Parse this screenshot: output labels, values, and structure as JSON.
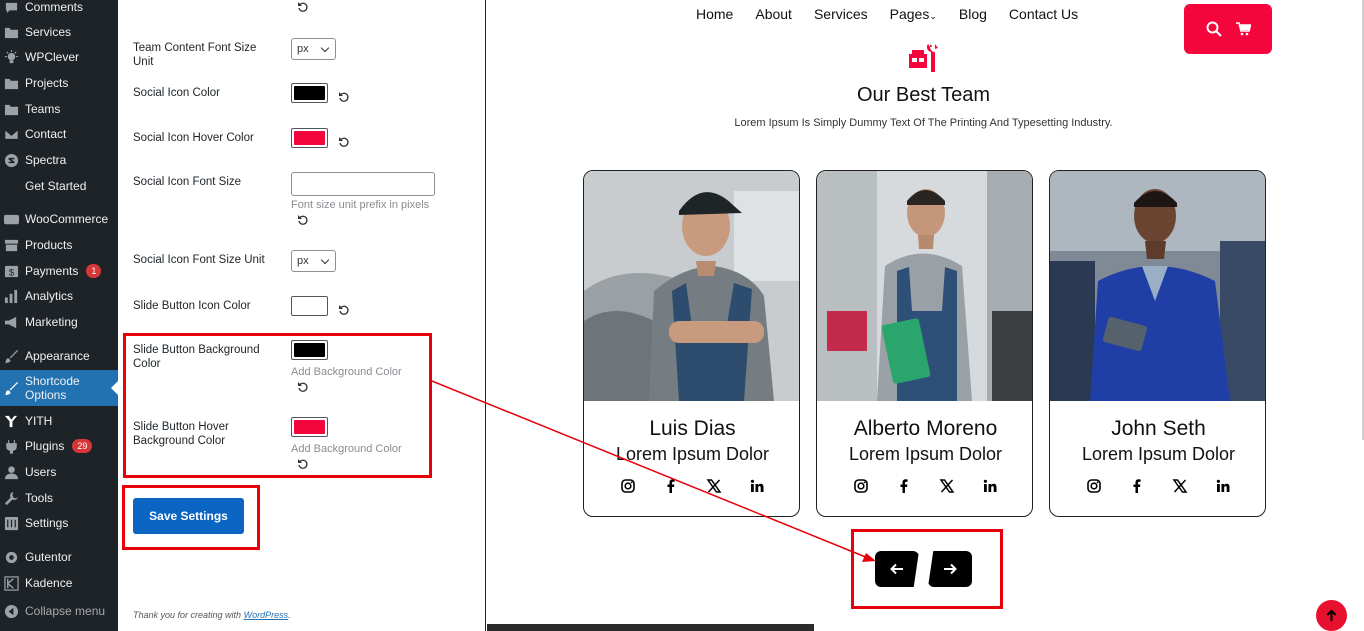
{
  "sidebar": {
    "items": [
      {
        "label": "Comments",
        "icon": "comments-icon"
      },
      {
        "label": "Services",
        "icon": "folder-icon"
      },
      {
        "label": "WPClever",
        "icon": "lightbulb-icon"
      },
      {
        "label": "Projects",
        "icon": "folder-icon"
      },
      {
        "label": "Teams",
        "icon": "folder-icon"
      },
      {
        "label": "Contact",
        "icon": "mail-icon"
      },
      {
        "label": "Spectra",
        "icon": "spectra-icon"
      },
      {
        "label": "Get Started",
        "icon": ""
      },
      {
        "label": "WooCommerce",
        "icon": "woo-icon"
      },
      {
        "label": "Products",
        "icon": "archive-icon"
      },
      {
        "label": "Payments",
        "icon": "dollar-icon",
        "badge": "1"
      },
      {
        "label": "Analytics",
        "icon": "bar-chart-icon"
      },
      {
        "label": "Marketing",
        "icon": "megaphone-icon"
      },
      {
        "label": "Appearance",
        "icon": "paintbrush-icon"
      },
      {
        "label": "Shortcode Options",
        "icon": "brush-icon",
        "active": true
      },
      {
        "label": "YITH",
        "icon": "yith-icon"
      },
      {
        "label": "Plugins",
        "icon": "plug-icon",
        "badge": "29"
      },
      {
        "label": "Users",
        "icon": "user-icon"
      },
      {
        "label": "Tools",
        "icon": "wrench-icon"
      },
      {
        "label": "Settings",
        "icon": "sliders-icon"
      },
      {
        "label": "Gutentor",
        "icon": "gear-icon"
      },
      {
        "label": "Kadence",
        "icon": "kadence-icon"
      },
      {
        "label": "Collapse menu",
        "icon": "collapse-icon"
      }
    ]
  },
  "settings": {
    "team_content_font_size_unit": {
      "label": "Team Content Font Size Unit",
      "value": "px"
    },
    "social_icon_color": {
      "label": "Social Icon Color",
      "color": "#000000"
    },
    "social_icon_hover_color": {
      "label": "Social Icon Hover Color",
      "color": "#f4053b"
    },
    "social_icon_font_size": {
      "label": "Social Icon Font Size",
      "value": "",
      "help": "Font size unit prefix in pixels"
    },
    "social_icon_font_size_unit": {
      "label": "Social Icon Font Size Unit",
      "value": "px"
    },
    "slide_button_icon_color": {
      "label": "Slide Button Icon Color",
      "color": "#ffffff"
    },
    "slide_button_bg_color": {
      "label": "Slide Button Background Color",
      "color": "#000000",
      "help": "Add Background Color"
    },
    "slide_button_hover_bg_color": {
      "label": "Slide Button Hover Background Color",
      "color": "#f4053b",
      "help": "Add Background Color"
    },
    "save_label": "Save Settings",
    "footer_prefix": "Thank you for creating with",
    "footer_link": "WordPress",
    "footer_suffix": "."
  },
  "preview": {
    "nav": [
      {
        "label": "Home"
      },
      {
        "label": "About"
      },
      {
        "label": "Services"
      },
      {
        "label": "Pages"
      },
      {
        "label": "Blog"
      },
      {
        "label": "Contact Us"
      }
    ],
    "title": "Our Best Team",
    "subtitle": "Lorem Ipsum Is Simply Dummy Text Of The Printing And Typesetting Industry.",
    "accent_color": "#f4053b",
    "cards": [
      {
        "name": "Luis Dias",
        "role": "Lorem Ipsum Dolor"
      },
      {
        "name": "Alberto Moreno",
        "role": "Lorem Ipsum Dolor"
      },
      {
        "name": "John Seth",
        "role": "Lorem Ipsum Dolor"
      }
    ],
    "socials": [
      "instagram-icon",
      "facebook-icon",
      "x-icon",
      "linkedin-icon"
    ]
  }
}
